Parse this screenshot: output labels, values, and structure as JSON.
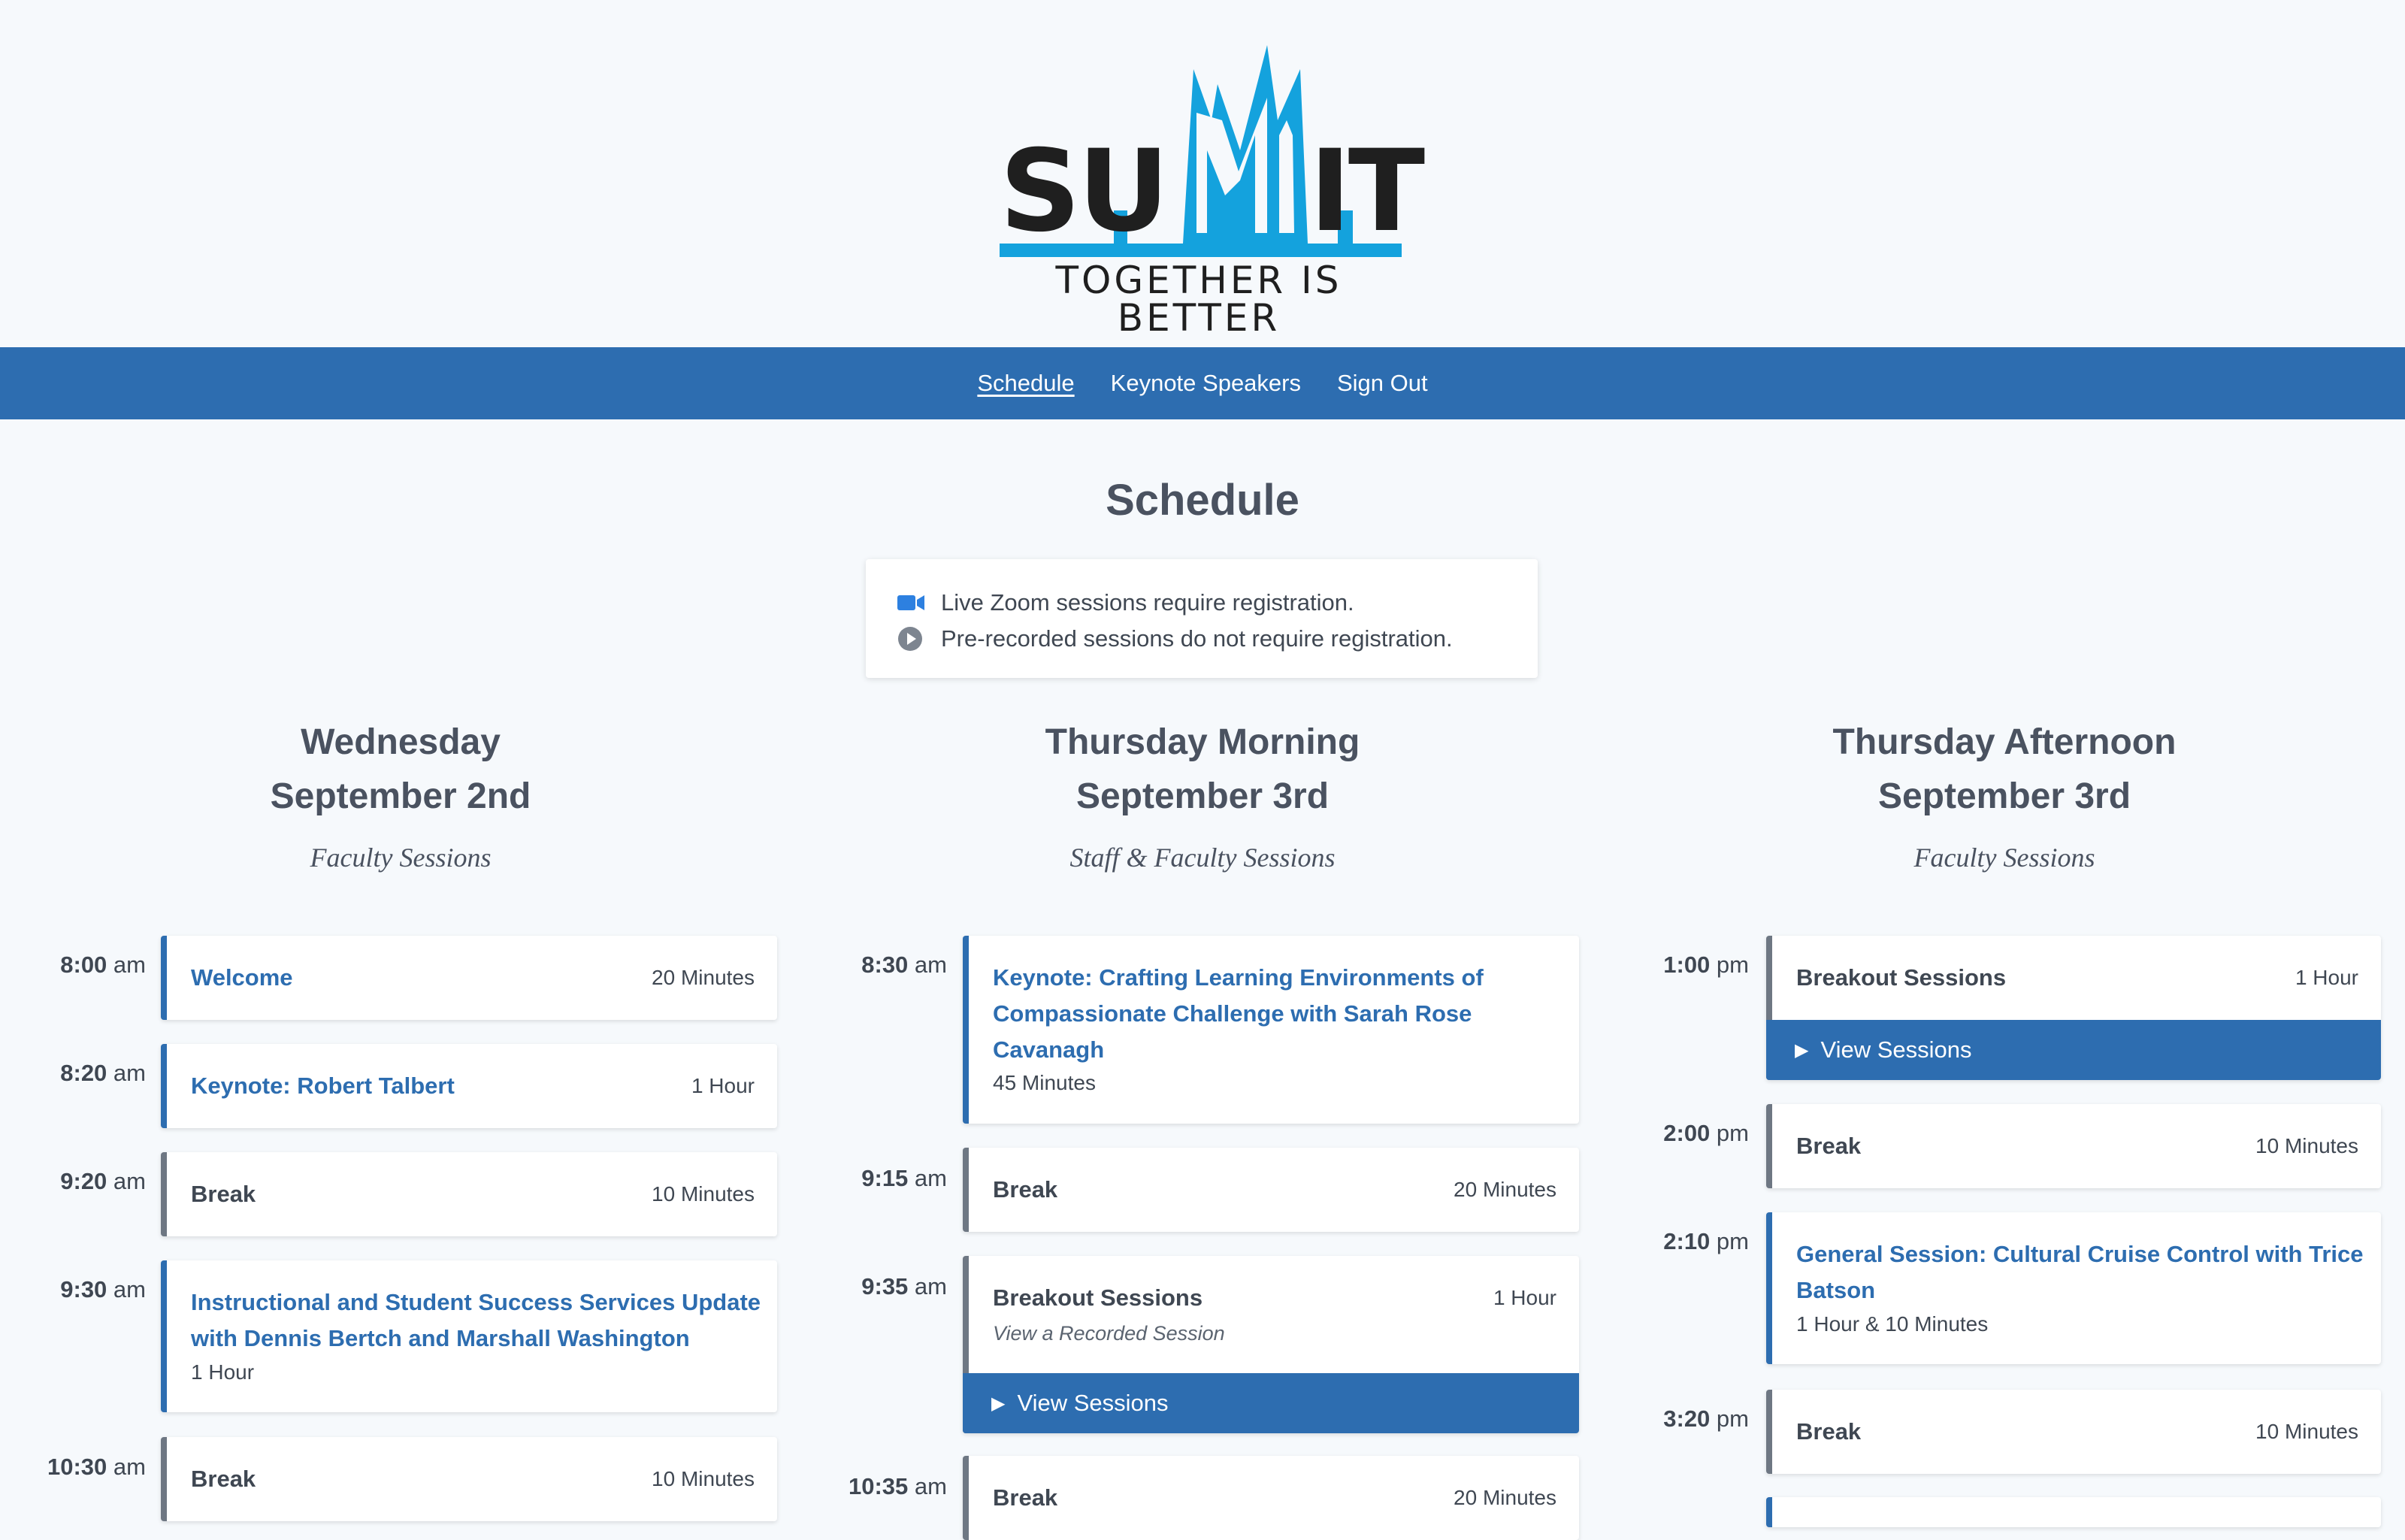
{
  "brand": {
    "word_left": "SU",
    "word_right": "IT",
    "tagline": "TOGETHER IS BETTER",
    "color_blue": "#14a2dd"
  },
  "nav": {
    "schedule": "Schedule",
    "keynote": "Keynote Speakers",
    "signout": "Sign Out"
  },
  "page": {
    "title": "Schedule"
  },
  "legend": {
    "zoom": "Live Zoom sessions require registration.",
    "recorded": "Pre-recorded sessions do not require registration."
  },
  "columns": [
    {
      "day": "Wednesday",
      "date": "September 2nd",
      "sub": "Faculty Sessions",
      "items": [
        {
          "time": "8:00",
          "ampm": "am",
          "title": "Welcome",
          "duration": "20 Minutes"
        },
        {
          "time": "8:20",
          "ampm": "am",
          "title": "Keynote: Robert Talbert",
          "duration": "1 Hour"
        },
        {
          "time": "9:20",
          "ampm": "am",
          "title": "Break",
          "duration": "10 Minutes"
        },
        {
          "time": "9:30",
          "ampm": "am",
          "title_line1": "Instructional and Student Success Services Update",
          "title_line2": "with Dennis Bertch and Marshall Washington",
          "duration": "1 Hour"
        },
        {
          "time": "10:30",
          "ampm": "am",
          "title": "Break",
          "duration": "10 Minutes"
        }
      ]
    },
    {
      "day": "Thursday Morning",
      "date": "September 3rd",
      "sub": "Staff & Faculty Sessions",
      "items": [
        {
          "time": "8:30",
          "ampm": "am",
          "title_line1": "Keynote: Crafting Learning Environments of",
          "title_line2": "Compassionate Challenge with Sarah Rose",
          "title_line3": "Cavanagh",
          "duration": "45 Minutes"
        },
        {
          "time": "9:15",
          "ampm": "am",
          "title": "Break",
          "duration": "20 Minutes"
        },
        {
          "time": "9:35",
          "ampm": "am",
          "title": "Breakout Sessions",
          "duration": "1 Hour",
          "note": "View a Recorded Session",
          "button": "View Sessions"
        },
        {
          "time": "10:35",
          "ampm": "am",
          "title": "Break",
          "duration": "20 Minutes"
        }
      ]
    },
    {
      "day": "Thursday Afternoon",
      "date": "September 3rd",
      "sub": "Faculty Sessions",
      "items": [
        {
          "time": "1:00",
          "ampm": "pm",
          "title": "Breakout Sessions",
          "duration": "1 Hour",
          "button": "View Sessions"
        },
        {
          "time": "2:00",
          "ampm": "pm",
          "title": "Break",
          "duration": "10 Minutes"
        },
        {
          "time": "2:10",
          "ampm": "pm",
          "title_line1": "General Session: Cultural Cruise Control with Trice",
          "title_line2": "Batson",
          "duration": "1 Hour & 10 Minutes"
        },
        {
          "time": "3:20",
          "ampm": "pm",
          "title": "Break",
          "duration": "10 Minutes"
        }
      ]
    }
  ]
}
